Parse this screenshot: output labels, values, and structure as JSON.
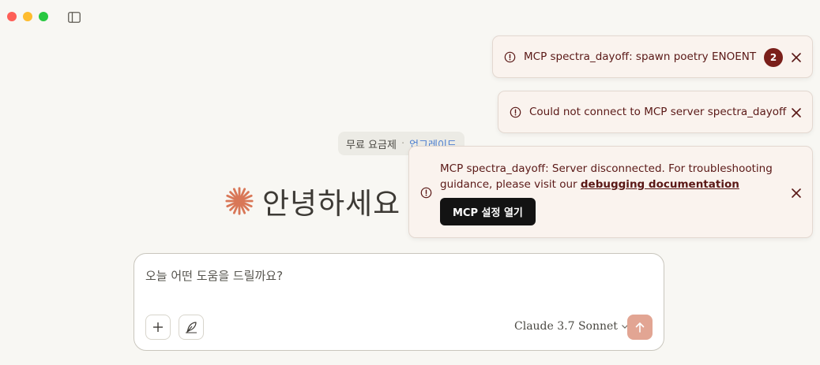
{
  "plan": {
    "label": "무료 요금제",
    "separator": "·",
    "upgrade": "업그레이드"
  },
  "greeting": {
    "text": "안녕하세요",
    "icon": "claude-spark-icon",
    "accent_color": "#d97757"
  },
  "composer": {
    "placeholder": "오늘 어떤 도움을 드릴까요?",
    "model": "Claude 3.7 Sonnet",
    "add_icon": "plus-icon",
    "style_icon": "feather-pen-icon",
    "send_icon": "arrow-up-icon"
  },
  "toasts": [
    {
      "message": "MCP spectra_dayoff: spawn poetry ENOENT",
      "count": "2",
      "icon": "alert-circle-icon"
    },
    {
      "message": "Could not connect to MCP server spectra_dayoff",
      "icon": "alert-circle-icon"
    },
    {
      "message": "MCP spectra_dayoff: Server disconnected. For troubleshooting guidance, please visit our",
      "link": "debugging documentation",
      "action": "MCP 설정 열기",
      "icon": "alert-circle-icon"
    }
  ],
  "colors": {
    "background": "#f8f7f3",
    "toast_text": "#5a1816",
    "badge": "#7a1f1a",
    "send_button": "#e2a593"
  }
}
